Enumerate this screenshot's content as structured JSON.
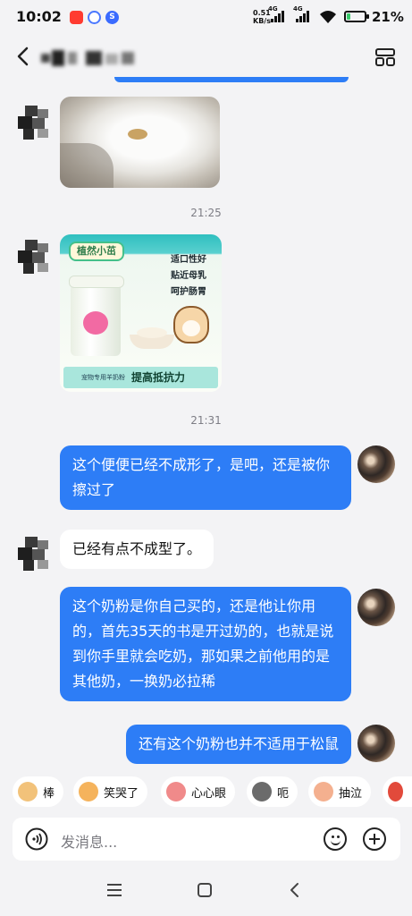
{
  "status_bar": {
    "time": "10:02",
    "net_speed_value": "0.51",
    "net_speed_unit": "KB/s",
    "signal1": "4G",
    "signal2": "4G",
    "battery": "21%",
    "battery_level": 0.21
  },
  "header": {
    "back_icon": "chevron-left-icon",
    "menu_icon": "grid-menu-icon"
  },
  "messages": {
    "time1": "21:25",
    "ad": {
      "brand": "植然小茁",
      "copy": "适口性好\n贴近母乳\n呵护肠胃",
      "bar_small": "宠物专用羊奶粉",
      "bar_big": "提高抵抗力"
    },
    "time2": "21:31",
    "msg1": "这个便便已经不成形了，是吧，还是被你擦过了",
    "msg2": "已经有点不成型了。",
    "msg3": "这个奶粉是你自己买的，还是他让你用的，首先35天的书是开过奶的，也就是说到你手里就会吃奶，那如果之前他用的是其他奶，一换奶必拉稀",
    "msg4": "还有这个奶粉也并不适用于松鼠"
  },
  "quick_replies": [
    {
      "label": "棒",
      "icon": "cat-thumbs-up-icon",
      "color": "#f2c27a"
    },
    {
      "label": "笑哭了",
      "icon": "cat-laugh-cry-icon",
      "color": "#f5b35c"
    },
    {
      "label": "心心眼",
      "icon": "cat-heart-eyes-icon",
      "color": "#f08a8a"
    },
    {
      "label": "呃",
      "icon": "cat-speechless-icon",
      "color": "#6b6b6b"
    },
    {
      "label": "抽泣",
      "icon": "cat-sobbing-icon",
      "color": "#f4b08f"
    },
    {
      "label": "",
      "icon": "cat-angry-icon",
      "color": "#e24a3b"
    }
  ],
  "input": {
    "placeholder": "发消息..."
  },
  "colors": {
    "sent_bubble": "#2d7df6",
    "received_bubble": "#ffffff",
    "background": "#f3f3f5"
  }
}
